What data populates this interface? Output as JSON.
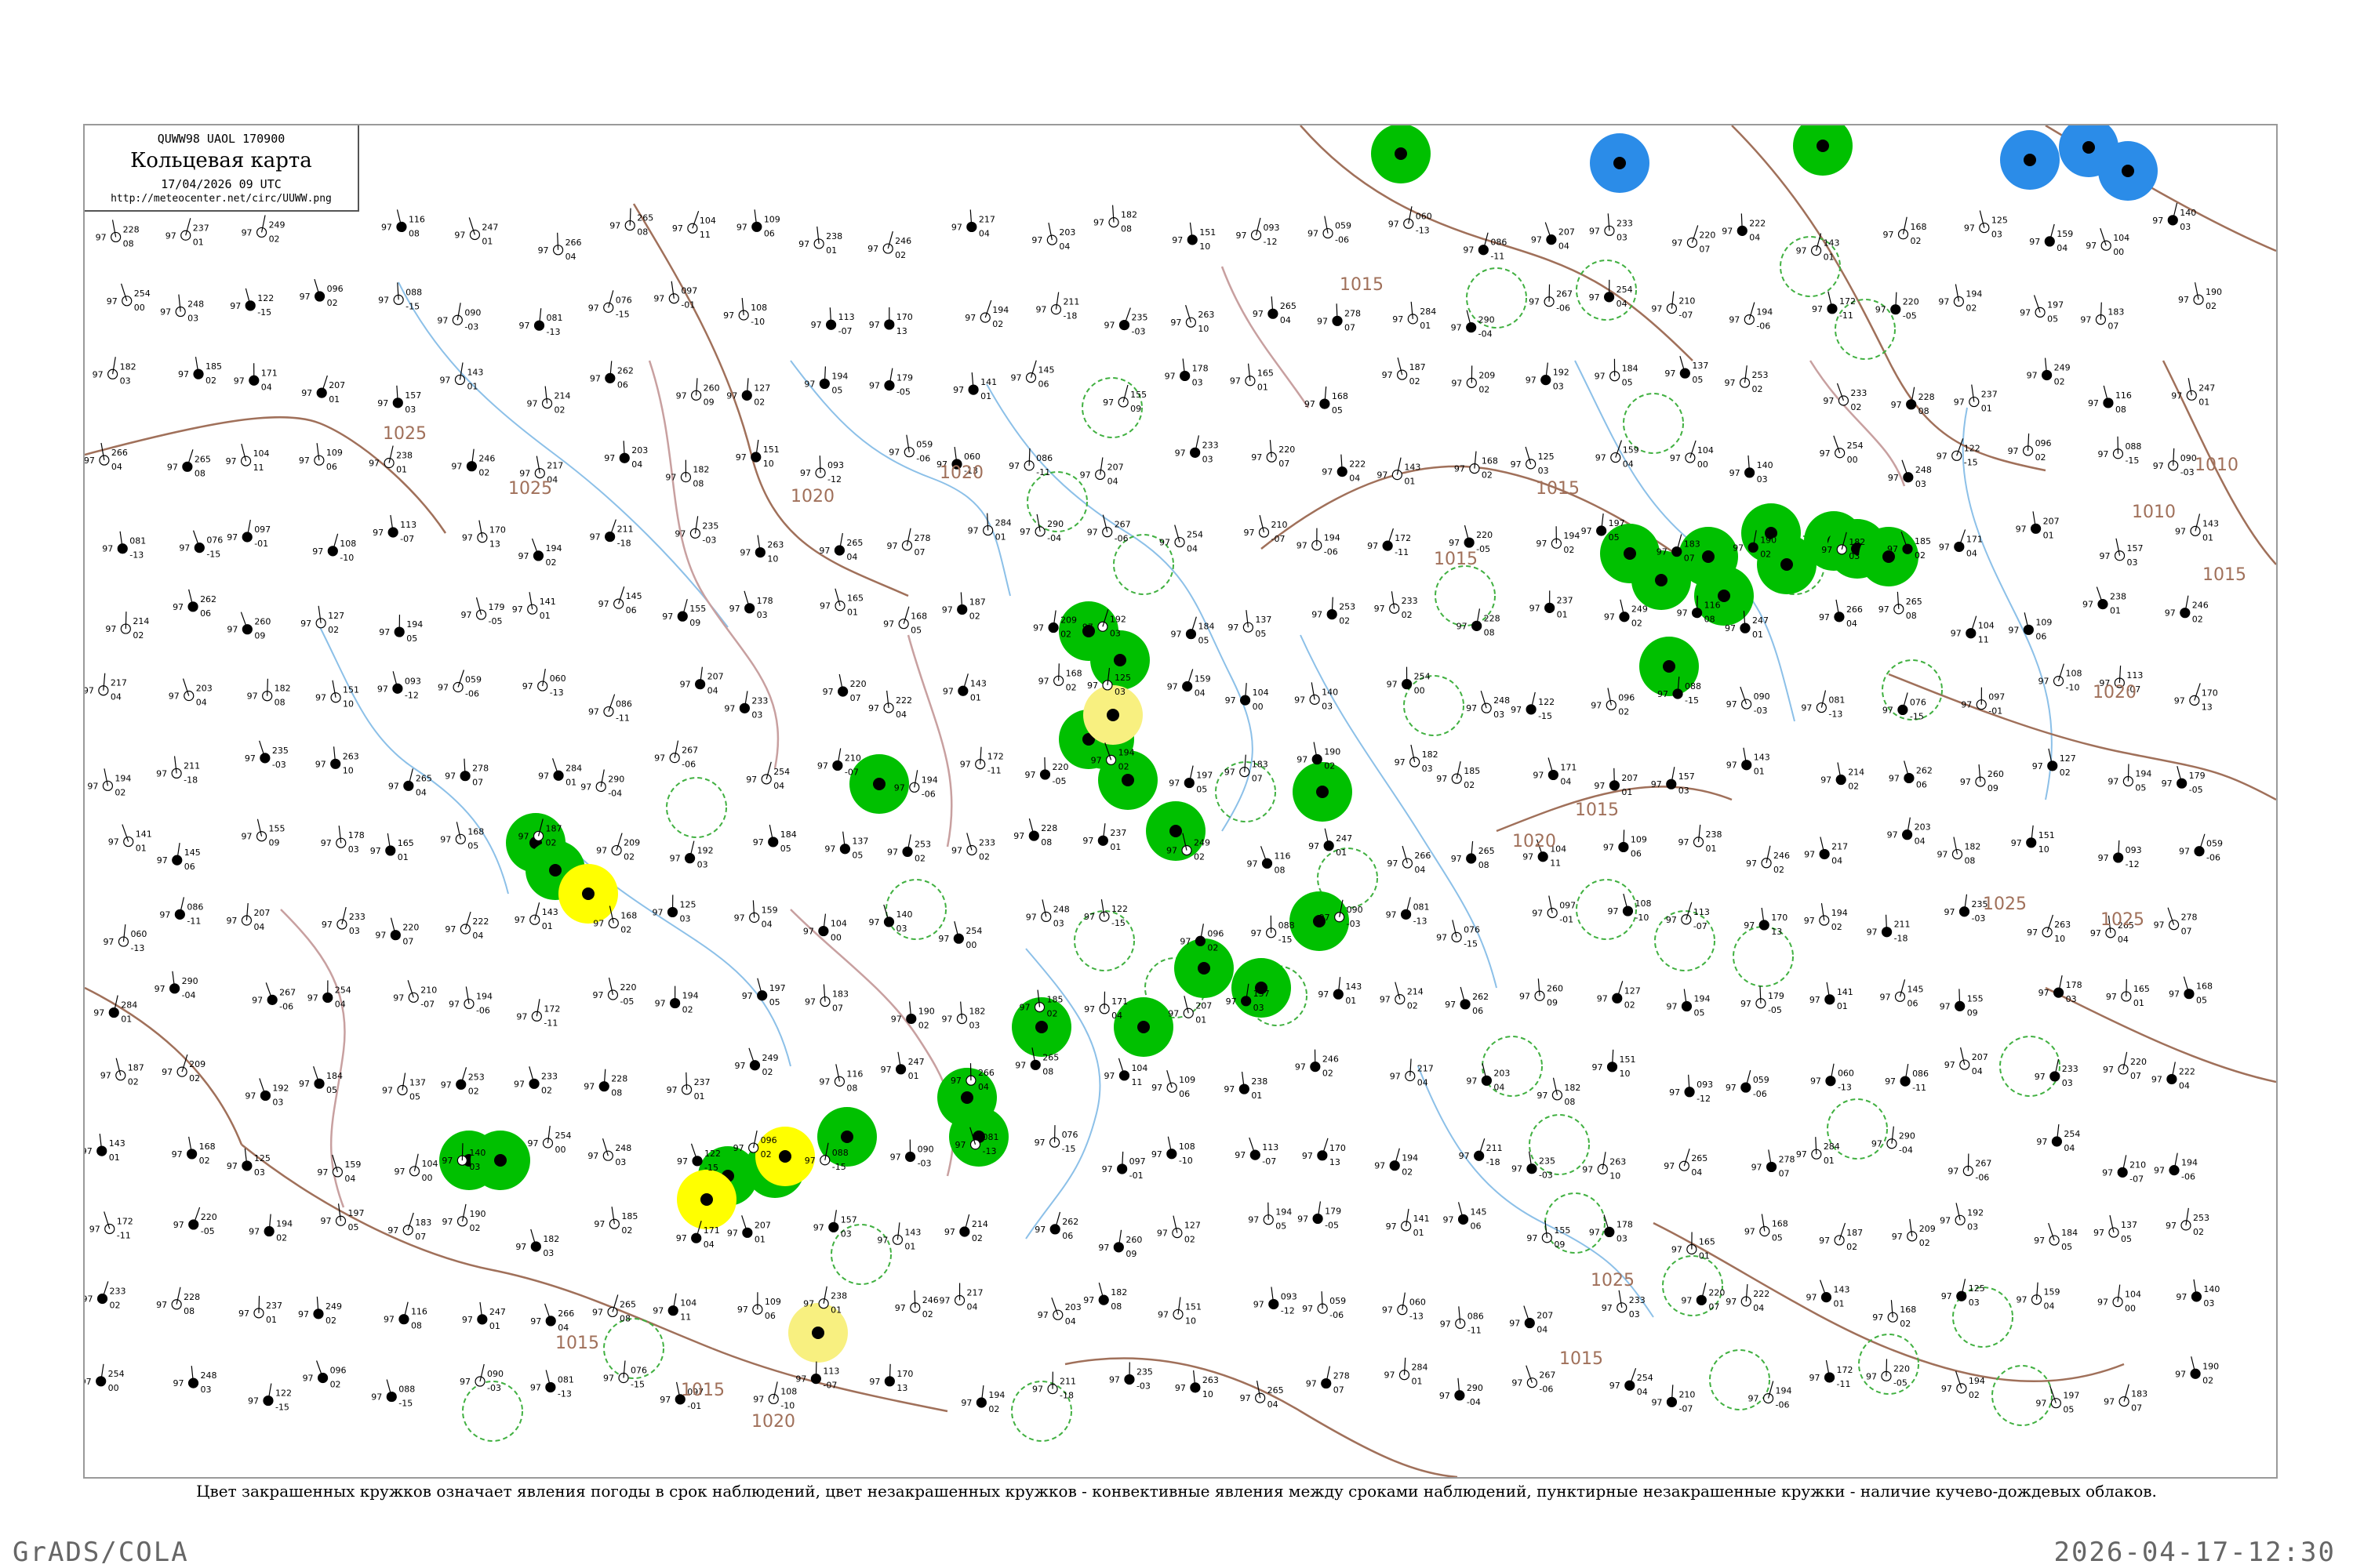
{
  "title_box": {
    "code_line": "QUWW98  UAOL  170900",
    "title": "Кольцевая карта",
    "time": "17/04/2026 09 UTC",
    "url": "http://meteocenter.net/circ/UUWW.png"
  },
  "legend_note": "Цвет закрашенных кружков означает явления погоды в срок наблюдений, цвет незакрашенных кружков - конвективные явления между сроками наблюдений, пунктирные незакрашенные кружки - наличие кучево-дождевых облаков.",
  "footer": {
    "left": "GrADS/COLA",
    "right": "2026-04-17-12:30"
  },
  "colors": {
    "isobar": "#a0705a",
    "river": "#8cc0e8",
    "border": "#c8a0a0",
    "shower_green": "#00c000",
    "snow_blue": "#2b8ce8",
    "fog_yellow": "#ffff00",
    "haze_lightyellow": "#f8f080",
    "cb_dashed": "#40b040"
  },
  "isobar_labels": [
    "1025",
    "1025",
    "1020",
    "1020",
    "1015",
    "1015",
    "1015",
    "1010",
    "1010",
    "1015",
    "1020",
    "1025",
    "1025",
    "1020",
    "1015",
    "1015",
    "1015",
    "1020",
    "1015",
    "1025"
  ],
  "stations": [
    {
      "v": "228",
      "p": "97",
      "t": "08"
    },
    {
      "v": "237",
      "p": "97",
      "t": "01"
    },
    {
      "v": "249",
      "p": "97",
      "t": "02"
    },
    {
      "v": "116",
      "p": "97",
      "t": "08"
    },
    {
      "v": "247",
      "p": "97",
      "t": "01"
    },
    {
      "v": "266",
      "p": "97",
      "t": "04"
    },
    {
      "v": "265",
      "p": "97",
      "t": "08"
    },
    {
      "v": "104",
      "p": "97",
      "t": "11"
    },
    {
      "v": "109",
      "p": "97",
      "t": "06"
    },
    {
      "v": "238",
      "p": "97",
      "t": "01"
    },
    {
      "v": "246",
      "p": "97",
      "t": "02"
    },
    {
      "v": "217",
      "p": "97",
      "t": "04"
    },
    {
      "v": "203",
      "p": "97",
      "t": "04"
    },
    {
      "v": "182",
      "p": "97",
      "t": "08"
    },
    {
      "v": "151",
      "p": "97",
      "t": "10"
    },
    {
      "v": "093",
      "p": "97",
      "t": "-12"
    },
    {
      "v": "059",
      "p": "97",
      "t": "-06"
    },
    {
      "v": "060",
      "p": "97",
      "t": "-13"
    },
    {
      "v": "086",
      "p": "97",
      "t": "-11"
    },
    {
      "v": "207",
      "p": "97",
      "t": "04"
    },
    {
      "v": "233",
      "p": "97",
      "t": "03"
    },
    {
      "v": "220",
      "p": "97",
      "t": "07"
    },
    {
      "v": "222",
      "p": "97",
      "t": "04"
    },
    {
      "v": "143",
      "p": "97",
      "t": "01"
    },
    {
      "v": "168",
      "p": "97",
      "t": "02"
    },
    {
      "v": "125",
      "p": "97",
      "t": "03"
    },
    {
      "v": "159",
      "p": "97",
      "t": "04"
    },
    {
      "v": "104",
      "p": "97",
      "t": "00"
    },
    {
      "v": "140",
      "p": "97",
      "t": "03"
    },
    {
      "v": "254",
      "p": "97",
      "t": "00"
    },
    {
      "v": "248",
      "p": "97",
      "t": "03"
    },
    {
      "v": "122",
      "p": "97",
      "t": "-15"
    },
    {
      "v": "096",
      "p": "97",
      "t": "02"
    },
    {
      "v": "088",
      "p": "97",
      "t": "-15"
    },
    {
      "v": "090",
      "p": "97",
      "t": "-03"
    },
    {
      "v": "081",
      "p": "97",
      "t": "-13"
    },
    {
      "v": "076",
      "p": "97",
      "t": "-15"
    },
    {
      "v": "097",
      "p": "97",
      "t": "-01"
    },
    {
      "v": "108",
      "p": "97",
      "t": "-10"
    },
    {
      "v": "113",
      "p": "97",
      "t": "-07"
    },
    {
      "v": "170",
      "p": "97",
      "t": "13"
    },
    {
      "v": "194",
      "p": "97",
      "t": "02"
    },
    {
      "v": "211",
      "p": "97",
      "t": "-18"
    },
    {
      "v": "235",
      "p": "97",
      "t": "-03"
    },
    {
      "v": "263",
      "p": "97",
      "t": "10"
    },
    {
      "v": "265",
      "p": "97",
      "t": "04"
    },
    {
      "v": "278",
      "p": "97",
      "t": "07"
    },
    {
      "v": "284",
      "p": "97",
      "t": "01"
    },
    {
      "v": "290",
      "p": "97",
      "t": "-04"
    },
    {
      "v": "267",
      "p": "97",
      "t": "-06"
    },
    {
      "v": "254",
      "p": "97",
      "t": "04"
    },
    {
      "v": "210",
      "p": "97",
      "t": "-07"
    },
    {
      "v": "194",
      "p": "97",
      "t": "-06"
    },
    {
      "v": "172",
      "p": "97",
      "t": "-11"
    },
    {
      "v": "220",
      "p": "97",
      "t": "-05"
    },
    {
      "v": "194",
      "p": "97",
      "t": "02"
    },
    {
      "v": "197",
      "p": "97",
      "t": "05"
    },
    {
      "v": "183",
      "p": "97",
      "t": "07"
    },
    {
      "v": "190",
      "p": "97",
      "t": "02"
    },
    {
      "v": "182",
      "p": "97",
      "t": "03"
    },
    {
      "v": "185",
      "p": "97",
      "t": "02"
    },
    {
      "v": "171",
      "p": "97",
      "t": "04"
    },
    {
      "v": "207",
      "p": "97",
      "t": "01"
    },
    {
      "v": "157",
      "p": "97",
      "t": "03"
    },
    {
      "v": "143",
      "p": "97",
      "t": "01"
    },
    {
      "v": "214",
      "p": "97",
      "t": "02"
    },
    {
      "v": "262",
      "p": "97",
      "t": "06"
    },
    {
      "v": "260",
      "p": "97",
      "t": "09"
    },
    {
      "v": "127",
      "p": "97",
      "t": "02"
    },
    {
      "v": "194",
      "p": "97",
      "t": "05"
    },
    {
      "v": "179",
      "p": "97",
      "t": "-05"
    },
    {
      "v": "141",
      "p": "97",
      "t": "01"
    },
    {
      "v": "145",
      "p": "97",
      "t": "06"
    },
    {
      "v": "155",
      "p": "97",
      "t": "09"
    },
    {
      "v": "178",
      "p": "97",
      "t": "03"
    },
    {
      "v": "165",
      "p": "97",
      "t": "01"
    },
    {
      "v": "168",
      "p": "97",
      "t": "05"
    },
    {
      "v": "187",
      "p": "97",
      "t": "02"
    },
    {
      "v": "209",
      "p": "97",
      "t": "02"
    },
    {
      "v": "192",
      "p": "97",
      "t": "03"
    },
    {
      "v": "184",
      "p": "97",
      "t": "05"
    },
    {
      "v": "137",
      "p": "97",
      "t": "05"
    },
    {
      "v": "253",
      "p": "97",
      "t": "02"
    },
    {
      "v": "233",
      "p": "97",
      "t": "02"
    }
  ]
}
